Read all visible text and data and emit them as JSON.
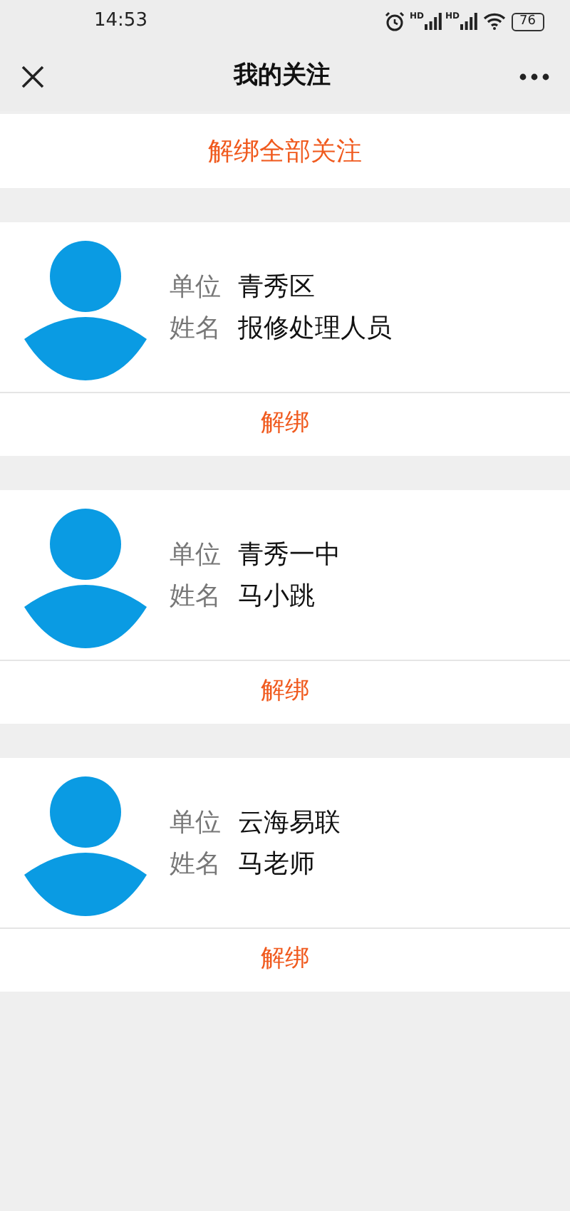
{
  "status_bar": {
    "time": "14:53",
    "signal_labels": [
      "HD",
      "HD"
    ],
    "battery": "76"
  },
  "nav": {
    "title": "我的关注"
  },
  "unbind_all": "解绑全部关注",
  "follows": [
    {
      "unit_label": "单位",
      "unit": "青秀区",
      "name_label": "姓名",
      "name": "报修处理人员",
      "action": "解绑"
    },
    {
      "unit_label": "单位",
      "unit": "青秀一中",
      "name_label": "姓名",
      "name": "马小跳",
      "action": "解绑"
    },
    {
      "unit_label": "单位",
      "unit": "云海易联",
      "name_label": "姓名",
      "name": "马老师",
      "action": "解绑"
    }
  ]
}
